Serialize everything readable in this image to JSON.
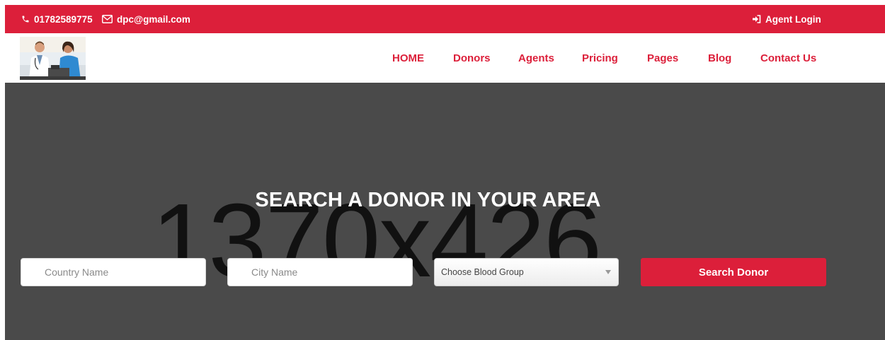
{
  "topbar": {
    "phone": "01782589775",
    "email": "dpc@gmail.com",
    "agent_login": "Agent Login",
    "icons": [
      "phone-icon",
      "envelope-icon",
      "sign-in-icon"
    ]
  },
  "header": {
    "logo_alt": "Doctor with patient",
    "nav": [
      "HOME",
      "Donors",
      "Agents",
      "Pricing",
      "Pages",
      "Blog",
      "Contact Us"
    ]
  },
  "hero": {
    "placeholder_size": "1370x426",
    "title": "SEARCH A DONOR IN YOUR AREA",
    "country_placeholder": "Country Name",
    "city_placeholder": "City Name",
    "blood_group_selected": "Choose Blood Group",
    "search_button": "Search Donor"
  },
  "colors": {
    "accent": "#dc1f3a",
    "hero_bg": "#4a4a4a",
    "white": "#ffffff"
  }
}
